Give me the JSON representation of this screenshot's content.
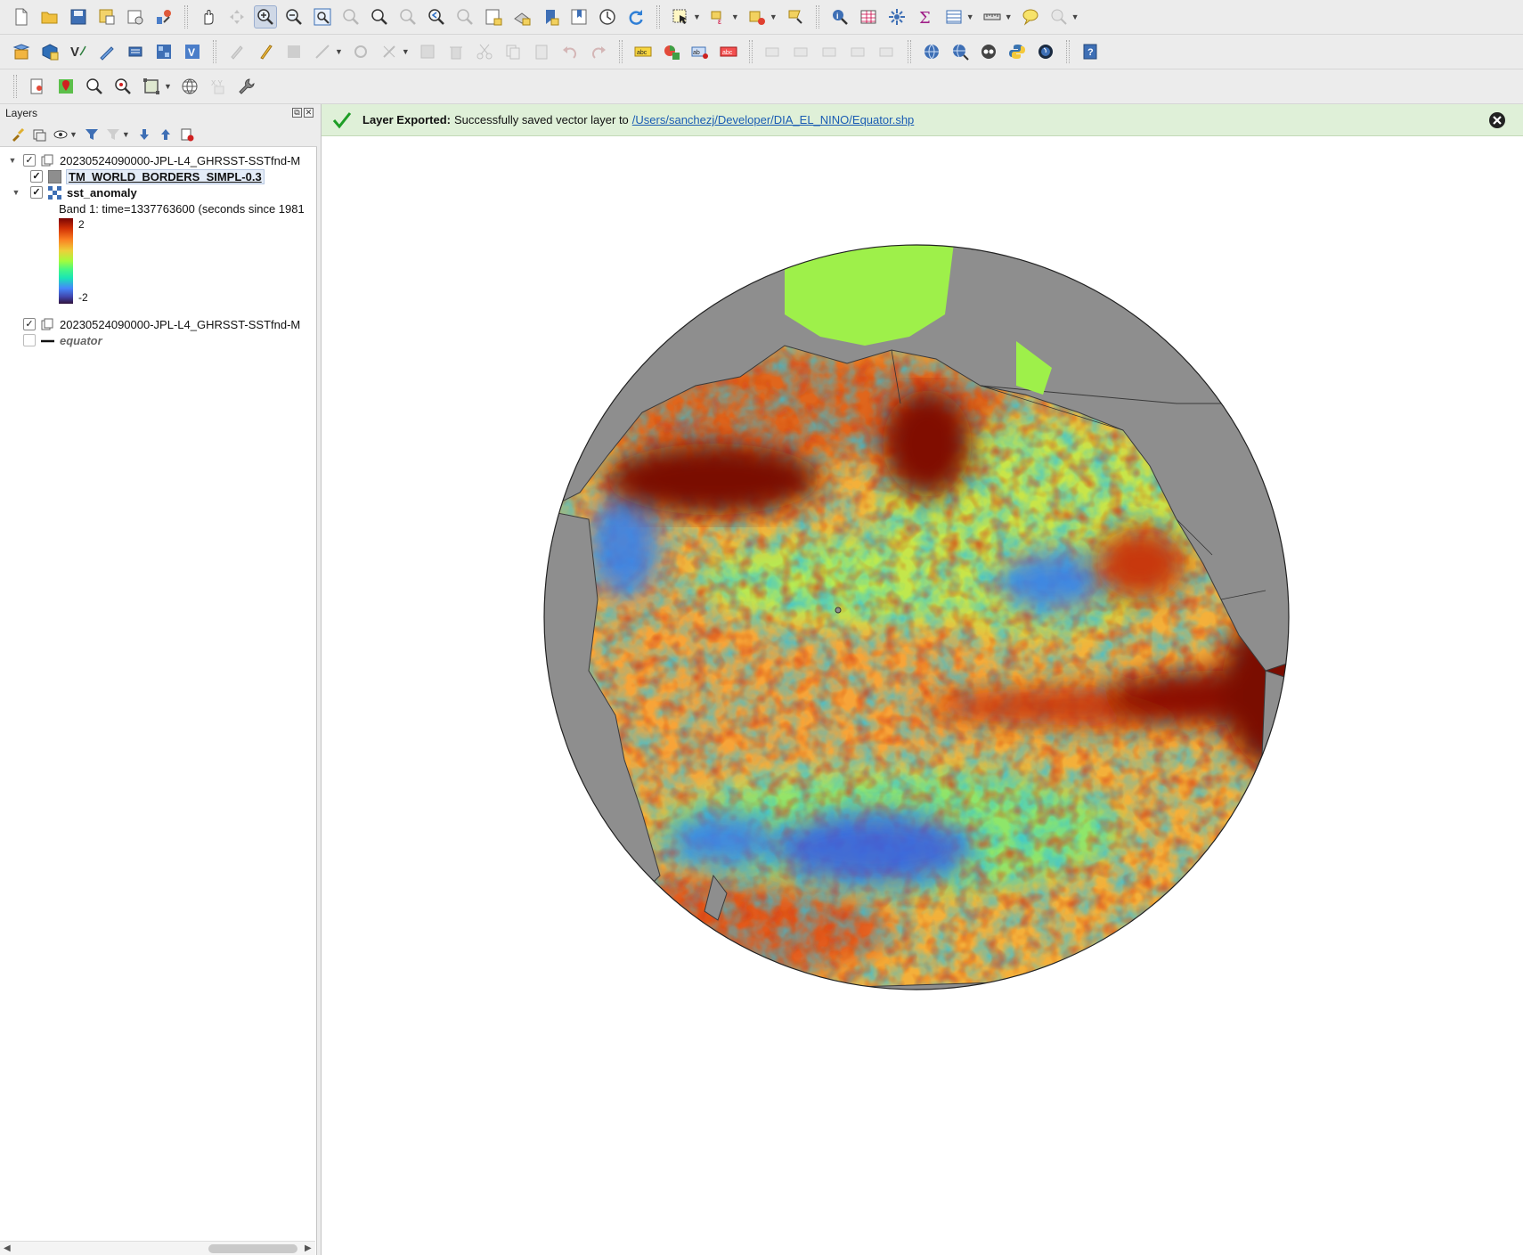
{
  "toolbars": {
    "row1": [
      "new-project",
      "open-project",
      "save-project",
      "save-as",
      "print-layout",
      "style-manager",
      "pan",
      "pan-to-selection",
      "zoom-in",
      "zoom-out",
      "zoom-full",
      "zoom-to-selection",
      "zoom-to-layer",
      "zoom-native",
      "zoom-last",
      "zoom-next",
      "new-map-view",
      "new-3d-map-view",
      "new-bookmark",
      "show-bookmarks",
      "temporal-controller",
      "refresh",
      "select-features",
      "select-by-value",
      "deselect",
      "select-by-location",
      "identify",
      "attribute-table",
      "field-calculator",
      "statistics",
      "open-table",
      "measure",
      "map-tips",
      "locator"
    ],
    "row2": [
      "data-source-manager",
      "new-geopackage",
      "new-virtual-layer",
      "digitize",
      "new-temporary-layer",
      "raster-calculator",
      "spatial-query",
      "current-edits",
      "toggle-editing",
      "save-edits",
      "add-feature",
      "vertex-tool",
      "modify-attributes",
      "delete-selected",
      "cut",
      "copy",
      "paste",
      "undo",
      "redo",
      "label-tool",
      "diagram-tool",
      "highlight-labels",
      "pin-labels",
      "show-hide-labels",
      "move-label",
      "rotate-label",
      "change-label",
      "plugins-web",
      "plugins-web-2",
      "qgis-cloud",
      "python-console",
      "globe",
      "help"
    ],
    "row3": [
      "georeferencer",
      "pin-tool",
      "zoom-tool",
      "pan-zoom",
      "extent-tool",
      "globe-projection",
      "xy-tool",
      "settings"
    ]
  },
  "layers_panel": {
    "title": "Layers",
    "tree": [
      {
        "name": "20230524090000-JPL-L4_GHRSST-SSTfnd-M",
        "checked": true
      },
      {
        "name": "TM_WORLD_BORDERS_SIMPL-0.3",
        "checked": true
      },
      {
        "name": "sst_anomaly",
        "checked": true
      },
      {
        "name": "20230524090000-JPL-L4_GHRSST-SSTfnd-M",
        "checked": true
      },
      {
        "name": "equator",
        "checked": false
      }
    ],
    "band_label": "Band 1: time=1337763600 (seconds since 1981",
    "legend_max": "2",
    "legend_min": "-2"
  },
  "message_bar": {
    "title": "Layer Exported:",
    "text": "Successfully saved vector layer to",
    "link": "/Users/sanchezj/Developer/DIA_EL_NINO/Equator.shp"
  },
  "colors": {
    "land": "#8e8e8e",
    "message_bg": "#dff0d8",
    "check_green": "#1e9e26"
  }
}
